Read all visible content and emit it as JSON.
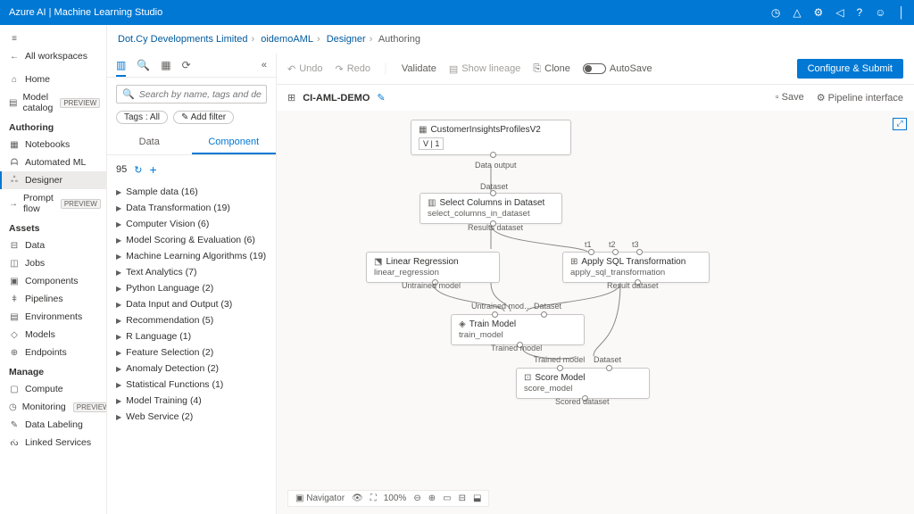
{
  "header": {
    "title": "Azure AI | Machine Learning Studio"
  },
  "breadcrumb": {
    "items": [
      "Dot.Cy Developments Limited",
      "oidemoAML",
      "Designer",
      "Authoring"
    ]
  },
  "sidebar": {
    "back": "All workspaces",
    "items_top": [
      {
        "icon": "⌂",
        "label": "Home"
      },
      {
        "icon": "▤",
        "label": "Model catalog",
        "badge": "PREVIEW"
      }
    ],
    "section_auth": "Authoring",
    "items_auth": [
      {
        "icon": "▦",
        "label": "Notebooks"
      },
      {
        "icon": "ᗩ",
        "label": "Automated ML"
      },
      {
        "icon": "ஃ",
        "label": "Designer",
        "active": true
      },
      {
        "icon": "→",
        "label": "Prompt flow",
        "badge": "PREVIEW"
      }
    ],
    "section_assets": "Assets",
    "items_assets": [
      {
        "icon": "⊟",
        "label": "Data"
      },
      {
        "icon": "◫",
        "label": "Jobs"
      },
      {
        "icon": "▣",
        "label": "Components"
      },
      {
        "icon": "ǂ",
        "label": "Pipelines"
      },
      {
        "icon": "▤",
        "label": "Environments"
      },
      {
        "icon": "◇",
        "label": "Models"
      },
      {
        "icon": "⊕",
        "label": "Endpoints"
      }
    ],
    "section_manage": "Manage",
    "items_manage": [
      {
        "icon": "▢",
        "label": "Compute"
      },
      {
        "icon": "◷",
        "label": "Monitoring",
        "badge": "PREVIEW"
      },
      {
        "icon": "✎",
        "label": "Data Labeling"
      },
      {
        "icon": "ᔔ",
        "label": "Linked Services"
      }
    ]
  },
  "panel": {
    "search_placeholder": "Search by name, tags and description",
    "tags_label": "Tags : All",
    "add_filter": "Add filter",
    "tab_data": "Data",
    "tab_component": "Component",
    "count": "95",
    "tree": [
      "Sample data (16)",
      "Data Transformation (19)",
      "Computer Vision (6)",
      "Model Scoring & Evaluation (6)",
      "Machine Learning Algorithms (19)",
      "Text Analytics (7)",
      "Python Language (2)",
      "Data Input and Output (3)",
      "Recommendation (5)",
      "R Language (1)",
      "Feature Selection (2)",
      "Anomaly Detection (2)",
      "Statistical Functions (1)",
      "Model Training (4)",
      "Web Service (2)"
    ]
  },
  "toolbar": {
    "undo": "Undo",
    "redo": "Redo",
    "validate": "Validate",
    "lineage": "Show lineage",
    "clone": "Clone",
    "autosave": "AutoSave",
    "submit": "Configure & Submit"
  },
  "pipeline": {
    "name": "CI-AML-DEMO",
    "save": "Save",
    "interface": "Pipeline interface"
  },
  "nodes": {
    "n1": {
      "title": "CustomerInsightsProfilesV2",
      "v": "V | 1",
      "out": "Data output"
    },
    "n2": {
      "title": "Select Columns in Dataset",
      "sub": "select_columns_in_dataset",
      "in": "Dataset",
      "out": "Results dataset"
    },
    "n3": {
      "title": "Linear Regression",
      "sub": "linear_regression",
      "out": "Untrained model"
    },
    "n4": {
      "title": "Apply SQL Transformation",
      "sub": "apply_sql_transformation",
      "in": "t1",
      "in2": "t2",
      "in3": "t3",
      "out": "Result dataset"
    },
    "n5": {
      "title": "Train Model",
      "sub": "train_model",
      "in1": "Untrained mod…",
      "in2": "Dataset",
      "out": "Trained model"
    },
    "n6": {
      "title": "Score Model",
      "sub": "score_model",
      "in1": "Trained model",
      "in2": "Dataset",
      "out": "Scored dataset"
    }
  },
  "bottombar": {
    "nav": "Navigator",
    "zoom": "100%"
  }
}
